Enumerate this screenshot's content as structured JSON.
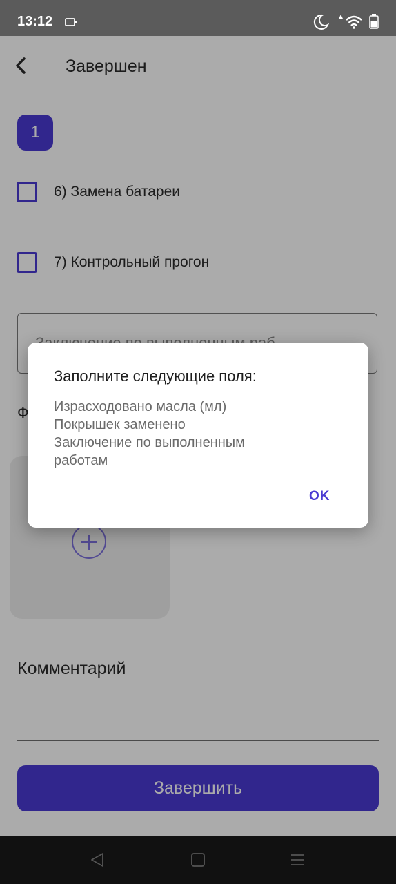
{
  "status_bar": {
    "time": "13:12",
    "icons": [
      "screen-record-icon",
      "moon-icon",
      "wifi-icon",
      "battery-icon"
    ]
  },
  "header": {
    "back_icon": "chevron-left-icon",
    "title": "Завершен"
  },
  "step": {
    "number": "1"
  },
  "checklist": [
    {
      "label": "6) Замена батареи",
      "checked": false
    },
    {
      "label": "7) Контрольный прогон",
      "checked": false
    }
  ],
  "conclusion_field": {
    "placeholder": "Заключение по выполненным раб"
  },
  "photo": {
    "label": "Ф",
    "add_icon": "plus-circle-icon"
  },
  "comment": {
    "label": "Комментарий"
  },
  "finish_button": {
    "label": "Завершить"
  },
  "dialog": {
    "title": "Заполните следующие поля:",
    "lines": [
      "Израсходовано масла (мл)",
      "Покрышек заменено",
      "Заключение по выполненным",
      "работам"
    ],
    "ok_label": "OK"
  },
  "nav_bar": {
    "icons": [
      "back-triangle-icon",
      "home-square-icon",
      "menu-lines-icon"
    ]
  },
  "colors": {
    "accent": "#4a3ad2",
    "scrim": "rgba(0,0,0,0.33)"
  }
}
